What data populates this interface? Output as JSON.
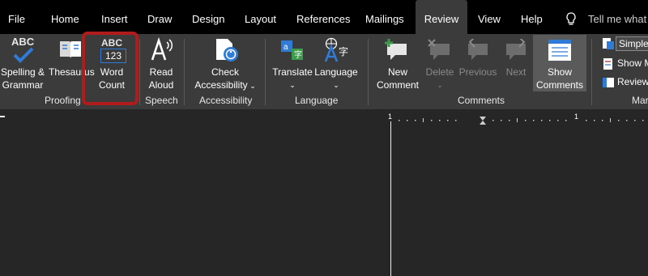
{
  "menu": {
    "file": "File",
    "home": "Home",
    "insert": "Insert",
    "draw": "Draw",
    "design": "Design",
    "layout": "Layout",
    "references": "References",
    "mailings": "Mailings",
    "review": "Review",
    "view": "View",
    "help": "Help",
    "tell_me": "Tell me what y"
  },
  "proofing": {
    "spelling_line1": "Spelling &",
    "spelling_line2": "Grammar",
    "spelling_icon_text": "ABC",
    "thesaurus": "Thesaurus",
    "word_count_line1": "Word",
    "word_count_line2": "Count",
    "word_count_icon_top": "ABC",
    "word_count_icon_bottom": "123",
    "group": "Proofing"
  },
  "speech": {
    "read_line1": "Read",
    "read_line2": "Aloud",
    "group": "Speech"
  },
  "accessibility": {
    "check_line1": "Check",
    "check_line2": "Accessibility",
    "group": "Accessibility"
  },
  "language": {
    "translate": "Translate",
    "language": "Language",
    "group": "Language"
  },
  "comments": {
    "new_line1": "New",
    "new_line2": "Comment",
    "delete": "Delete",
    "previous": "Previous",
    "next": "Next",
    "show_line1": "Show",
    "show_line2": "Comments",
    "group": "Comments"
  },
  "tracking": {
    "simple": "Simple",
    "show_markup": "Show M",
    "reviewing": "Review",
    "group": "Mar"
  },
  "ruler": {
    "mark1": "1",
    "mark2": "1"
  },
  "colors": {
    "menubar_bg": "#000000",
    "ribbon_bg": "#3b3b3b",
    "doc_bg": "#262626",
    "highlight_box": "#b01c1c",
    "check_blue": "#2f7bd6"
  }
}
